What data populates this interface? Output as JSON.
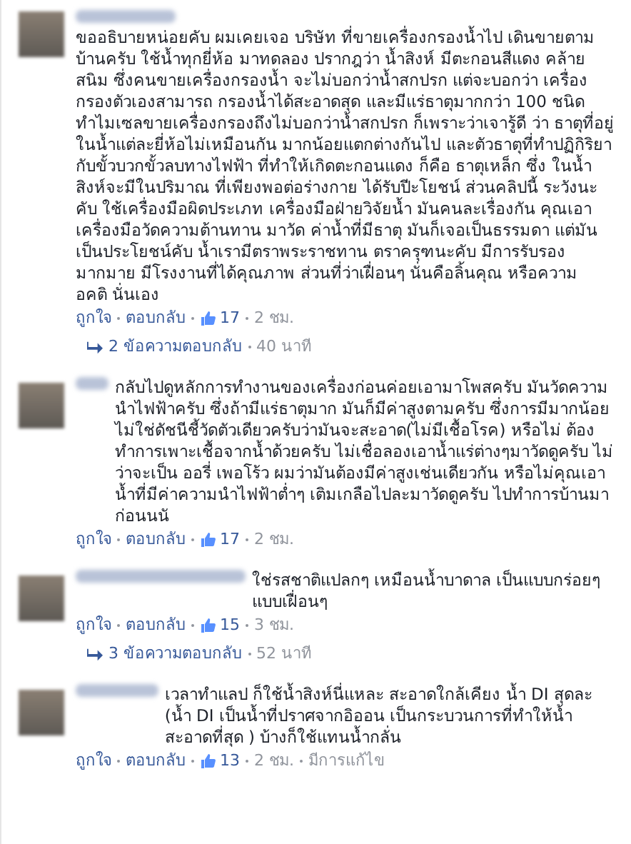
{
  "comments": [
    {
      "name_inline": false,
      "text": "ขออธิบายหน่อยคับ ผมเคยเจอ บริษัท ที่ขายเครื่องกรองน้ำไป เดินขายตามบ้านครับ ใช้น้ำทุกยี่ห้อ มาทดลอง ปรากฎว่า น้ำสิงห์ มีตะกอนสีแดง คล้ายสนิม ซึ่งคนขายเครื่องกรองน้ำ จะไม่บอกว่าน้ำสกปรก แต่จะบอกว่า เครื่องกรองตัวเองสามารถ กรองน้ำได้สะอาดสุด และมีแร่ธาตุมากกว่า 100 ชนิด ทำไมเซลขายเครื่องกรองถึงไม่บอกว่าน้ำสกปรก ก็เพราะว่าเจารู้ดี ว่า ธาตุที่อยู่ในน้ำแต่ละยี่ห้อไม่เหมือนกัน มากน้อยแตกต่างกันไป และตัวธาตุที่ทำปฏิกิริยา กับขั้วบวกขั้วลบทางไฟฟ้า ที่ทำให้เกิดตะกอนแดง ก็คือ ธาตุเหล็ก ซึ่ง ในน้ำสิงห์จะมีในปริมาณ ที่เพียงพอต่อร่างกาย ได้รับปีะโยชน์ ส่วนคลิปนี้ ระวังนะคับ ใช้เครื่องมือผิดประเภท เครื่องมือฝ่ายวิจัยน้ำ มันคนละเรื่องกัน คุณเอาเครื่องมือวัดความต้านทาน มาวัด ค่าน้ำที่มีธาตุ มันก็เจอเป็นธรรมดา แต่มันเป็นประโยชน์คับ น้ำเรามีตราพระราชทาน ตราครุฑนะคับ มีการรับรองมากมาย มีโรงงานที่ได้คุณภาพ ส่วนที่ว่าเฝื่อนๆ นั่นคือลิ้นคุณ หรือความ อคติ นั่นเอง",
      "like": "ถูกใจ",
      "reply": "ตอบกลับ",
      "likes": "17",
      "time": "2 ชม.",
      "replies": {
        "count": "2 ข้อความตอบกลับ",
        "time": "40 นาที"
      }
    },
    {
      "name_inline": true,
      "text": "กลับไปดูหลักการทำงานของเครื่องก่อนค่อยเอามาโพสครับ มันวัดความนำไฟฟ้าครับ ซึ่งถ้ามีแร่ธาตุมาก มันก็มีค่าสูงตามครับ ซึ่งการมีมากน้อยไม่ใช่ดัชนีชี้วัดตัวเดียวครับว่ามันจะสะอาด(ไม่มีเชื้อโรค) หรือไม่ ต้องทำการเพาะเชื้อจากน้ำด้วยครับ ไม่เชื่อลองเอาน้ำแร่ต่างๆมาวัดดูครับ ไม่ว่าจะเป็น ออรี่ เพอโร้ว ผมว่ามันต้องมีค่าสูงเช่นเดียวกัน หรือไม่คุณเอาน้ำที่มีค่าความนำไฟฟ้าต่ำๆ เติมเกลือไปละมาวัดดูครับ ไปทำการบ้านมาก่อนนนั",
      "like": "ถูกใจ",
      "reply": "ตอบกลับ",
      "likes": "17",
      "time": "2 ชม."
    },
    {
      "name_inline": true,
      "text": "ใช่รสชาติแปลกๆ เหมือนน้ำบาดาล เป็นแบบกร่อยๆแบบเฝื่อนๆ",
      "like": "ถูกใจ",
      "reply": "ตอบกลับ",
      "likes": "15",
      "time": "3 ชม.",
      "replies": {
        "count": "3 ข้อความตอบกลับ",
        "time": "52 นาที"
      }
    },
    {
      "name_inline": true,
      "text": "เวลาทำแลป ก็ใช้น้ำสิงห์นี่แหละ สะอาดใกล้เคียง น้ำ DI สุดละ (น้ำ DI เป็นน้ำที่ปราศจากอิออน เป็นกระบวนการที่ทำให้น้ำสะอาดที่สุด ) บ้างก็ใช้แทนน้ำกลั่น",
      "like": "ถูกใจ",
      "reply": "ตอบกลับ",
      "likes": "13",
      "time": "2 ชม.",
      "edited": "มีการแก้ไข"
    }
  ]
}
